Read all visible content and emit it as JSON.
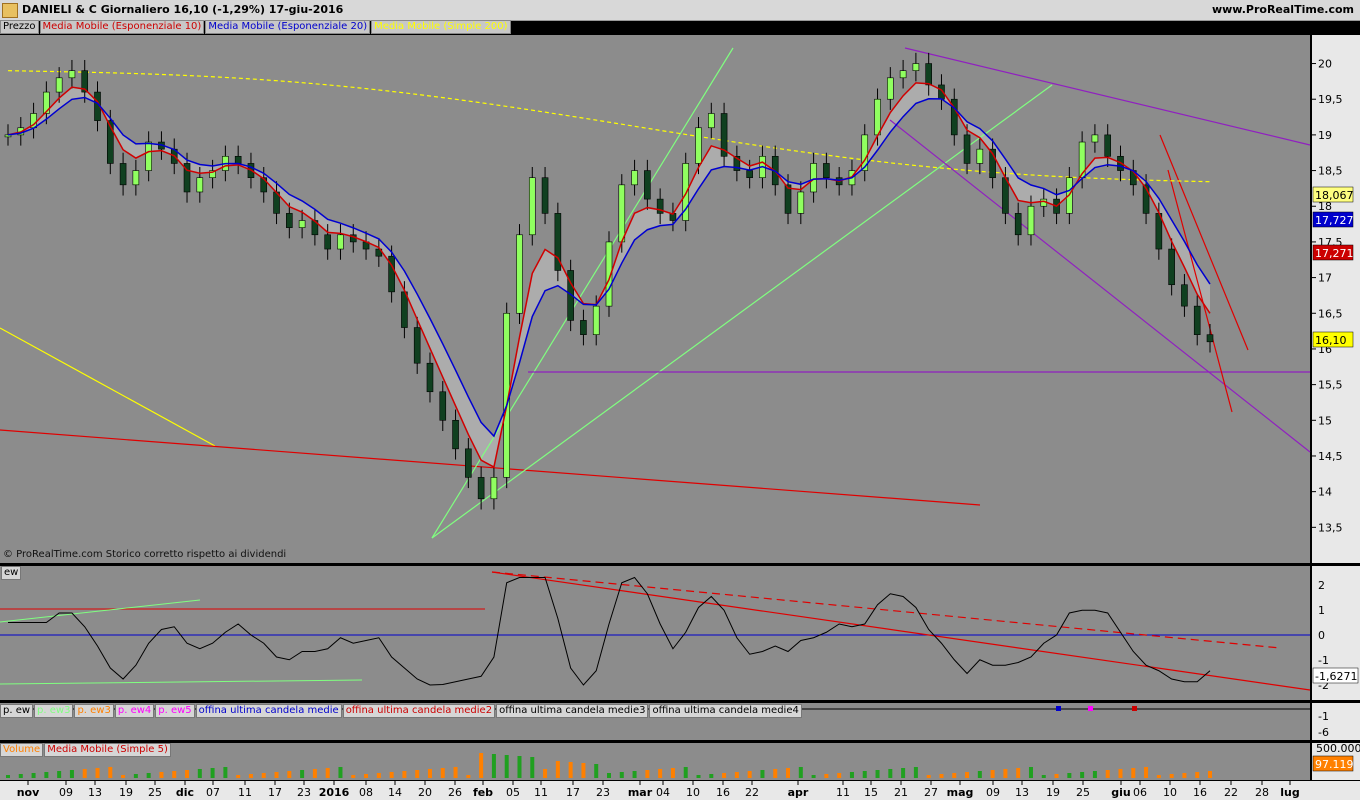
{
  "header": {
    "title": "DANIELI & C    Giornaliero    16,10 (-1,29%)    17-giu-2016",
    "site": "www.ProRealTime.com"
  },
  "legend": [
    {
      "label": "Prezzo",
      "color": "#000000"
    },
    {
      "label": "Media Mobile (Esponenziale 10)",
      "color": "#cc0000"
    },
    {
      "label": "Media Mobile (Esponenziale 20)",
      "color": "#0000cc"
    },
    {
      "label": "Media Mobile (Simple 200)",
      "color": "#ffff00"
    }
  ],
  "copyright": "© ProRealTime.com  Storico corretto rispetto ai dividendi",
  "ew_label": "ew",
  "ew_legend": [
    {
      "label": "p. ew",
      "color": "#000000"
    },
    {
      "label": "p. ew3",
      "color": "#80ff80"
    },
    {
      "label": "p. ew3",
      "color": "#ff8000"
    },
    {
      "label": "p. ew4",
      "color": "#ff00ff"
    },
    {
      "label": "p. ew5",
      "color": "#ff00ff"
    },
    {
      "label": "offina ultima candela medie",
      "color": "#0000cc"
    },
    {
      "label": "offina ultima candela medie2",
      "color": "#cc0000"
    },
    {
      "label": "offina ultima candela medie3",
      "color": "#000000"
    },
    {
      "label": "offina ultima candela medie4",
      "color": "#000000"
    }
  ],
  "volume_legend": [
    {
      "label": "Volume",
      "color": "#ff8000"
    },
    {
      "label": "Media Mobile (Simple 5)",
      "color": "#cc0000"
    }
  ],
  "chart_data": {
    "type": "candlestick",
    "price_axis": {
      "ticks": [
        "20",
        "19,5",
        "19",
        "18,5",
        "18",
        "17,5",
        "17",
        "16,5",
        "16",
        "15,5",
        "15",
        "14,5",
        "14",
        "13,5"
      ],
      "min": 13.0,
      "max": 20.4
    },
    "price_tags": [
      {
        "value": "18,067",
        "bg": "#ffff80",
        "fg": "#000000"
      },
      {
        "value": "17,727",
        "bg": "#0000cc",
        "fg": "#ffffff"
      },
      {
        "value": "17,271",
        "bg": "#cc0000",
        "fg": "#ffffff"
      },
      {
        "value": "16,10",
        "bg": "#ffff00",
        "fg": "#000000"
      }
    ],
    "ew_axis": {
      "ticks": [
        "2",
        "1",
        "0",
        "-1",
        "-2"
      ],
      "tag": "-1,6271"
    },
    "ew_small_axis": {
      "ticks": [
        "-1",
        "-6"
      ]
    },
    "volume_axis": {
      "ticks": [
        "500.000"
      ],
      "tag": "97.119"
    },
    "x_ticks": [
      "nov",
      "09",
      "13",
      "19",
      "25",
      "dic",
      "07",
      "11",
      "17",
      "23",
      "2016",
      "08",
      "14",
      "20",
      "26",
      "feb",
      "05",
      "11",
      "17",
      "23",
      "mar",
      "04",
      "10",
      "16",
      "22",
      "apr",
      "11",
      "15",
      "21",
      "27",
      "mag",
      "09",
      "13",
      "19",
      "25",
      "giu",
      "06",
      "10",
      "16",
      "22",
      "28",
      "lug"
    ],
    "series": [
      {
        "name": "Prezzo",
        "values": [
          19.0,
          19.1,
          19.3,
          19.6,
          19.8,
          19.9,
          19.6,
          19.2,
          18.6,
          18.3,
          18.5,
          18.9,
          18.8,
          18.6,
          18.2,
          18.4,
          18.5,
          18.7,
          18.6,
          18.4,
          18.2,
          17.9,
          17.7,
          17.8,
          17.6,
          17.4,
          17.6,
          17.5,
          17.4,
          17.3,
          16.8,
          16.3,
          15.8,
          15.4,
          15.0,
          14.6,
          14.2,
          13.9,
          14.2,
          16.5,
          17.6,
          18.4,
          17.9,
          17.1,
          16.4,
          16.2,
          16.6,
          17.5,
          18.3,
          18.5,
          18.1,
          17.9,
          17.8,
          18.6,
          19.1,
          19.3,
          18.7,
          18.5,
          18.4,
          18.7,
          18.3,
          17.9,
          18.2,
          18.6,
          18.4,
          18.3,
          18.5,
          19.0,
          19.5,
          19.8,
          19.9,
          20.0,
          19.7,
          19.5,
          19.0,
          18.6,
          18.8,
          18.4,
          17.9,
          17.6,
          18.0,
          18.1,
          17.9,
          18.4,
          18.9,
          19.0,
          18.7,
          18.5,
          18.3,
          17.9,
          17.4,
          16.9,
          16.6,
          16.2,
          16.1
        ]
      },
      {
        "name": "Media Mobile (Esponenziale 10)"
      },
      {
        "name": "Media Mobile (Esponenziale 20)"
      },
      {
        "name": "Media Mobile (Simple 200)"
      }
    ]
  }
}
